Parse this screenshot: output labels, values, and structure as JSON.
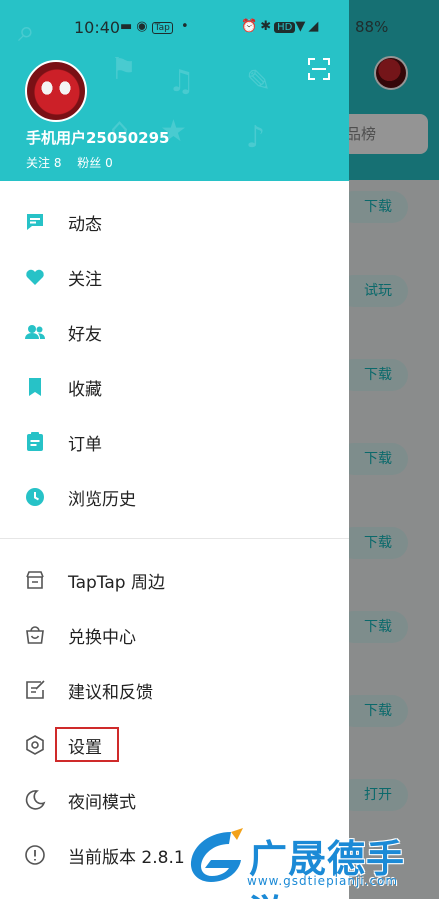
{
  "status_bar": {
    "time": "10:40",
    "left_icons": [
      "image-icon",
      "record-icon",
      "taptap-icon",
      "dot-icon"
    ],
    "tap_badge": "Tap",
    "right_icons": [
      "alarm-icon",
      "vibrate-icon",
      "hd-icon",
      "wifi-icon",
      "signal-icon"
    ],
    "hd_label": "HD",
    "battery": "88%"
  },
  "profile": {
    "name": "手机用户25050295",
    "following_label": "关注 8",
    "fans_label": "粉丝 0"
  },
  "menu_primary": [
    {
      "label": "动态",
      "icon": "feed-icon"
    },
    {
      "label": "关注",
      "icon": "heart-icon"
    },
    {
      "label": "好友",
      "icon": "friends-icon"
    },
    {
      "label": "收藏",
      "icon": "bookmark-icon"
    },
    {
      "label": "订单",
      "icon": "order-icon"
    },
    {
      "label": "浏览历史",
      "icon": "clock-icon"
    }
  ],
  "menu_secondary": [
    {
      "label": "TapTap 周边",
      "icon": "store-icon"
    },
    {
      "label": "兑换中心",
      "icon": "bag-icon"
    },
    {
      "label": "建议和反馈",
      "icon": "feedback-icon"
    },
    {
      "label": "设置",
      "icon": "settings-icon"
    },
    {
      "label": "夜间模式",
      "icon": "moon-icon"
    },
    {
      "label": "当前版本 2.8.1",
      "icon": "info-icon"
    }
  ],
  "background": {
    "tab_label": "品榜",
    "buttons": [
      "下载",
      "试玩",
      "下载",
      "下载",
      "下载",
      "下载",
      "下载",
      "打开"
    ]
  },
  "watermark": {
    "title": "广晟德手游",
    "url": "www.gsdtiepianji.com"
  },
  "colors": {
    "accent": "#27c2c7",
    "highlight_border": "#cf2a2a",
    "watermark": "#1b8ad6"
  }
}
